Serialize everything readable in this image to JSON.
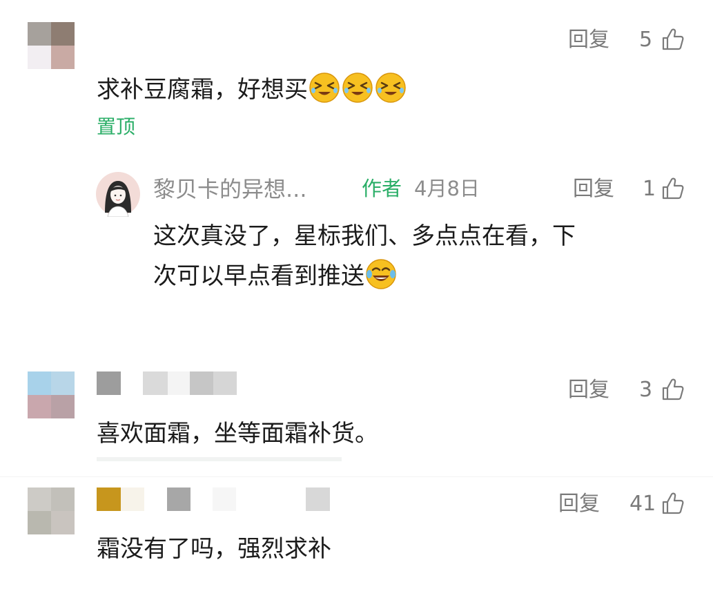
{
  "comments": [
    {
      "text": "求补豆腐霜，好想买",
      "badge": "置顶",
      "reply_label": "回复",
      "likes": "5",
      "emoji_count": 3,
      "reply": {
        "name": "黎贝卡的异想...",
        "role": "作者",
        "date": "4月8日",
        "reply_label": "回复",
        "likes": "1",
        "line1": "这次真没了，星标我们、多点点在看，下",
        "line2": "次可以早点看到推送"
      }
    },
    {
      "text": "喜欢面霜，坐等面霜补货。",
      "reply_label": "回复",
      "likes": "3"
    },
    {
      "text": "霜没有了吗，强烈求补",
      "reply_label": "回复",
      "likes": "41"
    }
  ],
  "colors": {
    "accent_green": "#2aae67",
    "meta_gray": "#7a7a7a",
    "name_gray": "#8c8c8c"
  },
  "icons": [
    "thumb-up-icon",
    "grin-squint-emoji-icon",
    "tears-of-joy-emoji-icon"
  ]
}
